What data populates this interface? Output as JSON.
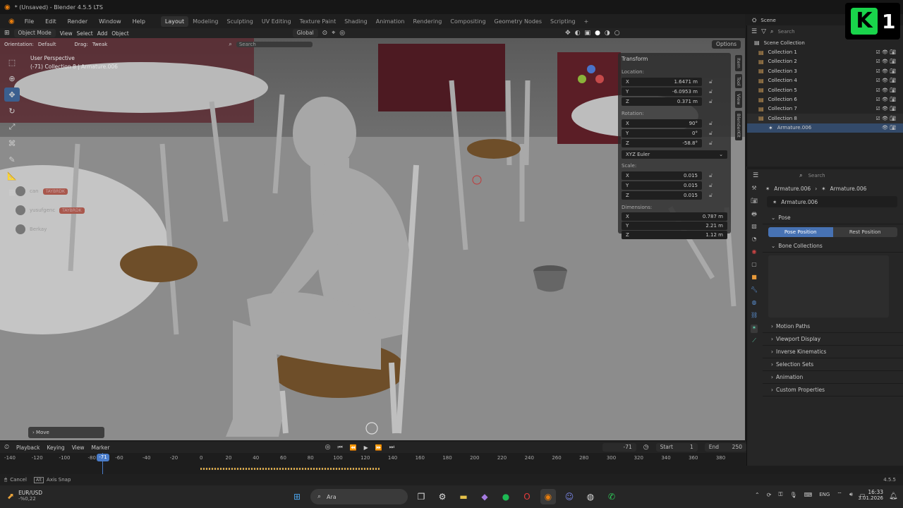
{
  "window": {
    "title": "* (Unsaved) - Blender 4.5.5 LTS"
  },
  "menu": {
    "items": [
      "File",
      "Edit",
      "Render",
      "Window",
      "Help"
    ],
    "workspaces": [
      "Layout",
      "Modeling",
      "Sculpting",
      "UV Editing",
      "Texture Paint",
      "Shading",
      "Animation",
      "Rendering",
      "Compositing",
      "Geometry Nodes",
      "Scripting"
    ],
    "active_workspace": "Layout",
    "scene_label": "Scene"
  },
  "header": {
    "mode": "Object Mode",
    "view": "View",
    "select": "Select",
    "add": "Add",
    "object": "Object",
    "transform_orientation": "Global",
    "orientation_label": "Orientation:",
    "orientation_value": "Default",
    "drag_label": "Drag:",
    "drag_value": "Tweak",
    "search_placeholder": "Search",
    "options": "Options"
  },
  "viewport": {
    "perspective": "User Perspective",
    "collection_info": "(-71) Collection 8 | Armature.006",
    "operator_panel": "Move",
    "overlay_chat": [
      {
        "name": "can",
        "tag": "TAYBRDK"
      },
      {
        "name": "yusufgenc",
        "tag": "TAYBRDK"
      },
      {
        "name": "Berkay",
        "tag": ""
      }
    ]
  },
  "npanel": {
    "title": "Transform",
    "location_label": "Location:",
    "location": [
      {
        "axis": "X",
        "value": "1.6471 m"
      },
      {
        "axis": "Y",
        "value": "-6.0953 m"
      },
      {
        "axis": "Z",
        "value": "0.371 m"
      }
    ],
    "rotation_label": "Rotation:",
    "rotation": [
      {
        "axis": "X",
        "value": "90°"
      },
      {
        "axis": "Y",
        "value": "0°"
      },
      {
        "axis": "Z",
        "value": "-58.8°"
      }
    ],
    "rotation_mode": "XYZ Euler",
    "scale_label": "Scale:",
    "scale": [
      {
        "axis": "X",
        "value": "0.015"
      },
      {
        "axis": "Y",
        "value": "0.015"
      },
      {
        "axis": "Z",
        "value": "0.015"
      }
    ],
    "dimensions_label": "Dimensions:",
    "dimensions": [
      {
        "axis": "X",
        "value": "0.787 m"
      },
      {
        "axis": "Y",
        "value": "2.21 m"
      },
      {
        "axis": "Z",
        "value": "1.12 m"
      }
    ],
    "side_tabs": [
      "Item",
      "Tool",
      "View",
      "BlenderKit"
    ]
  },
  "outliner": {
    "search_placeholder": "Search",
    "root": "Scene Collection",
    "collections": [
      "Collection 1",
      "Collection 2",
      "Collection 3",
      "Collection 4",
      "Collection 5",
      "Collection 6",
      "Collection 7",
      "Collection 8"
    ],
    "selected_child": "Armature.006"
  },
  "properties": {
    "search_placeholder": "Search",
    "breadcrumb_a": "Armature.006",
    "breadcrumb_b": "Armature.006",
    "data_name": "Armature.006",
    "pose_section": "Pose",
    "pose_position": "Pose Position",
    "rest_position": "Rest Position",
    "bone_collections": "Bone Collections",
    "sections": [
      "Motion Paths",
      "Viewport Display",
      "Inverse Kinematics",
      "Selection Sets",
      "Animation",
      "Custom Properties"
    ]
  },
  "timeline": {
    "playback": "Playback",
    "keying": "Keying",
    "view": "View",
    "marker": "Marker",
    "current_frame": "-71",
    "start_label": "Start",
    "start": "1",
    "end_label": "End",
    "end": "250",
    "ticks": [
      "-140",
      "-120",
      "-100",
      "-80",
      "-60",
      "-40",
      "-20",
      "0",
      "20",
      "40",
      "60",
      "80",
      "100",
      "120",
      "140",
      "160",
      "180",
      "200",
      "220",
      "240",
      "260",
      "280",
      "300",
      "320",
      "340",
      "360",
      "380"
    ],
    "playhead": "-71"
  },
  "status": {
    "cancel": "Cancel",
    "axis_snap": "Axis Snap",
    "version": "4.5.5"
  },
  "taskbar": {
    "ticker_name": "EUR/USD",
    "ticker_change": "-%0,22",
    "search_placeholder": "Ara",
    "language": "ENG",
    "time": "16:33",
    "date": "3.01.2026"
  },
  "badge": {
    "letter": "K",
    "digit": "1"
  },
  "colors": {
    "accent": "#4772b3",
    "selected": "#334a6a",
    "collection_icon": "#d9a45a"
  }
}
